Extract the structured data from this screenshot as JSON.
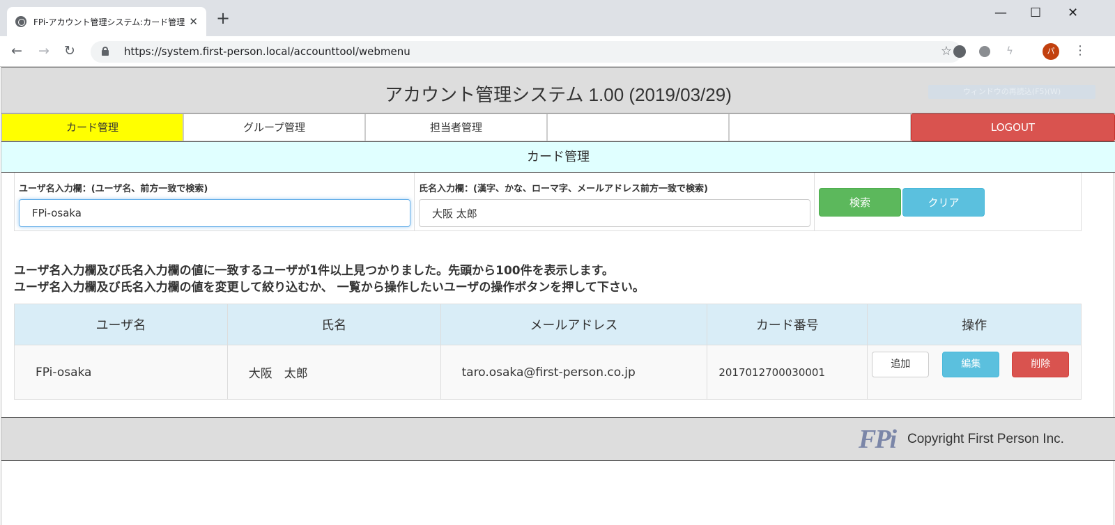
{
  "browser": {
    "tab_title": "FPi-アカウント管理システム:カード管理",
    "tab_close": "✕",
    "new_tab": "+",
    "url": "https://system.first-person.local/accounttool/webmenu",
    "profile_initial": "パ",
    "controls": {
      "minimize": "—",
      "maximize": "☐",
      "close": "✕"
    }
  },
  "app": {
    "title": "アカウント管理システム 1.00 (2019/03/29)",
    "header_button": "ウィンドウの再読込(F5)(W)"
  },
  "menu": {
    "items": [
      {
        "label": "カード管理",
        "active": true
      },
      {
        "label": "グループ管理",
        "active": false
      },
      {
        "label": "担当者管理",
        "active": false
      },
      {
        "label": "",
        "active": false
      },
      {
        "label": "",
        "active": false
      }
    ],
    "logout": "LOGOUT"
  },
  "section_title": "カード管理",
  "search": {
    "username_label": "ユーザ名入力欄：(ユーザ名、前方一致で検索)",
    "username_value": "FPi-osaka",
    "name_label": "氏名入力欄：(漢字、かな、ローマ字、メールアドレス前方一致で検索)",
    "name_value": "大阪 太郎",
    "search_button": "検索",
    "clear_button": "クリア"
  },
  "message": {
    "line1": "ユーザ名入力欄及び氏名入力欄の値に一致するユーザが1件以上見つかりました。先頭から100件を表示します。",
    "line2": "ユーザ名入力欄及び氏名入力欄の値を変更して絞り込むか、 一覧から操作したいユーザの操作ボタンを押して下さい。"
  },
  "table": {
    "headers": [
      "ユーザ名",
      "氏名",
      "メールアドレス",
      "カード番号",
      "操作"
    ],
    "rows": [
      {
        "username": "FPi-osaka",
        "name": "大阪　太郎",
        "email": "taro.osaka@first-person.co.jp",
        "card": "2017012700030001",
        "add": "追加",
        "edit": "編集",
        "delete": "削除"
      }
    ]
  },
  "footer": {
    "logo": "FPi",
    "copyright": "Copyright First Person Inc."
  }
}
